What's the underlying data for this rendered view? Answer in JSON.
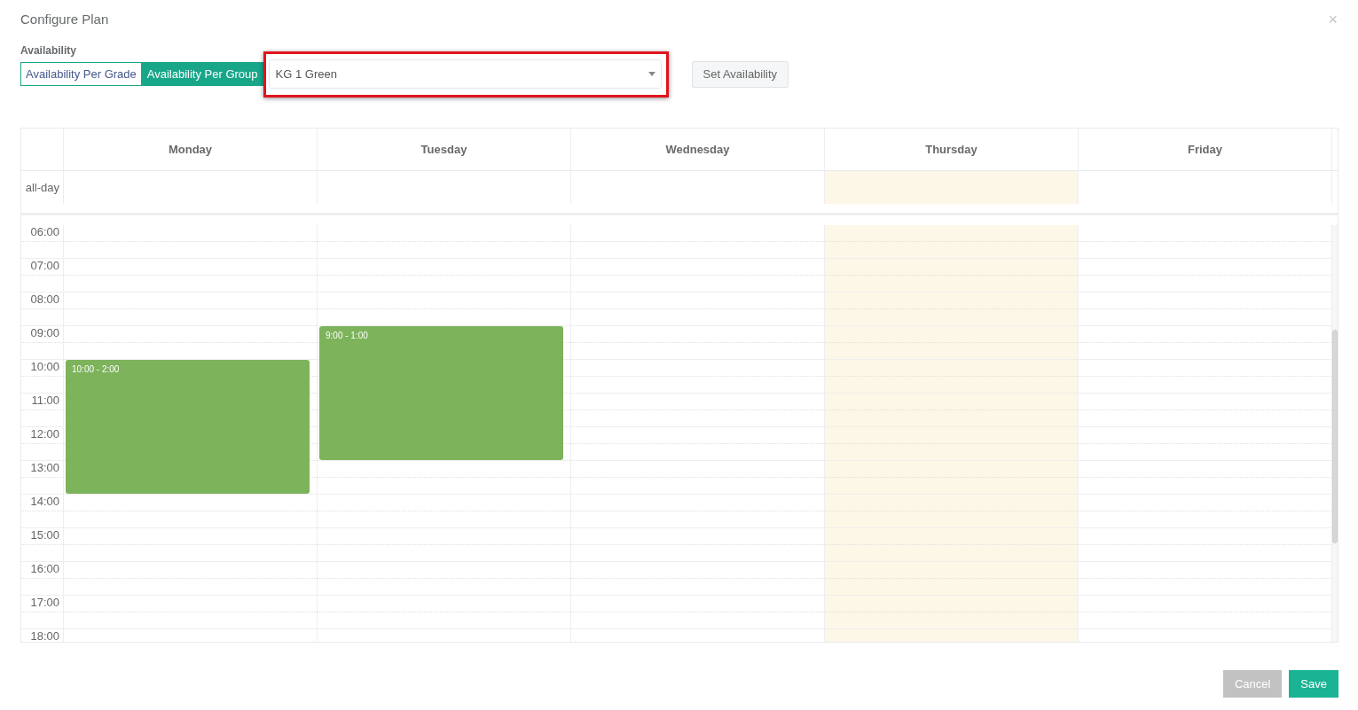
{
  "dialog": {
    "title": "Configure Plan",
    "close": "×"
  },
  "availability": {
    "label": "Availability",
    "modes": [
      {
        "label": "Availability Per Grade",
        "selected": false
      },
      {
        "label": "Availability Per Group",
        "selected": true
      }
    ],
    "group_select": {
      "value": "KG 1 Green",
      "highlighted": true
    },
    "set_button": "Set Availability"
  },
  "calendar": {
    "all_day_label": "all-day",
    "hours": [
      "06:00",
      "07:00",
      "08:00",
      "09:00",
      "10:00",
      "11:00",
      "12:00",
      "13:00",
      "14:00",
      "15:00",
      "16:00",
      "17:00",
      "18:00"
    ],
    "days": [
      {
        "name": "Monday",
        "today": false,
        "slots": [
          {
            "available": false
          },
          {
            "available": false
          },
          {
            "available": false
          },
          {
            "available": false
          },
          {
            "available": true,
            "label": "10:00 - 2:00"
          },
          {
            "available": true
          },
          {
            "available": true
          },
          {
            "available": true
          },
          {
            "available": false
          },
          {
            "available": false
          },
          {
            "available": false
          },
          {
            "available": false
          }
        ]
      },
      {
        "name": "Tuesday",
        "today": false,
        "slots": [
          {
            "available": false
          },
          {
            "available": false
          },
          {
            "available": false
          },
          {
            "available": true,
            "label": "9:00 - 1:00"
          },
          {
            "available": true
          },
          {
            "available": true
          },
          {
            "available": true
          },
          {
            "available": false
          },
          {
            "available": false
          },
          {
            "available": false
          },
          {
            "available": false
          },
          {
            "available": false
          }
        ]
      },
      {
        "name": "Wednesday",
        "today": false
      },
      {
        "name": "Thursday",
        "today": true
      },
      {
        "name": "Friday",
        "today": false
      }
    ]
  },
  "buttons": [
    {
      "label": "Cancel",
      "kind": "secondary"
    },
    {
      "label": "Save",
      "kind": "primary"
    }
  ]
}
